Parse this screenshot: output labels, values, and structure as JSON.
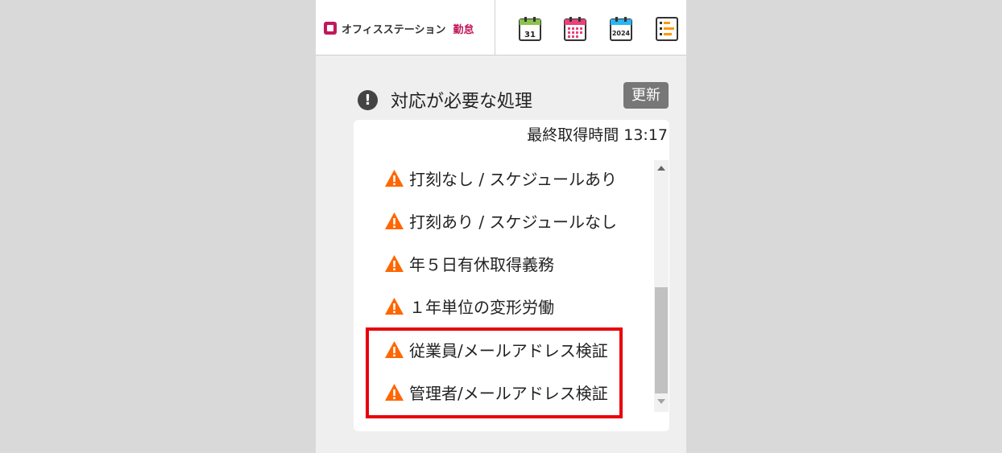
{
  "header": {
    "logo_text": "オフィスステーション",
    "logo_accent": "勤怠",
    "toolbar": [
      {
        "icon": "calendar-day-icon",
        "text": "31"
      },
      {
        "icon": "calendar-month-icon",
        "text": ""
      },
      {
        "icon": "calendar-year-icon",
        "text": "2024"
      },
      {
        "icon": "list-schedule-icon",
        "text": ""
      }
    ]
  },
  "section": {
    "title": "対応が必要な処理",
    "refresh_label": "更新",
    "last_fetch": "最終取得時間 13:17"
  },
  "items": [
    {
      "label": "打刻なし / スケジュールあり"
    },
    {
      "label": "打刻あり / スケジュールなし"
    },
    {
      "label": "年５日有休取得義務"
    },
    {
      "label": "１年単位の変形労働"
    },
    {
      "label": "従業員/メールアドレス検証"
    },
    {
      "label": "管理者/メールアドレス検証"
    }
  ],
  "colors": {
    "warning": "#ff6600",
    "brand": "#c2185b",
    "highlight": "#e8000b"
  }
}
